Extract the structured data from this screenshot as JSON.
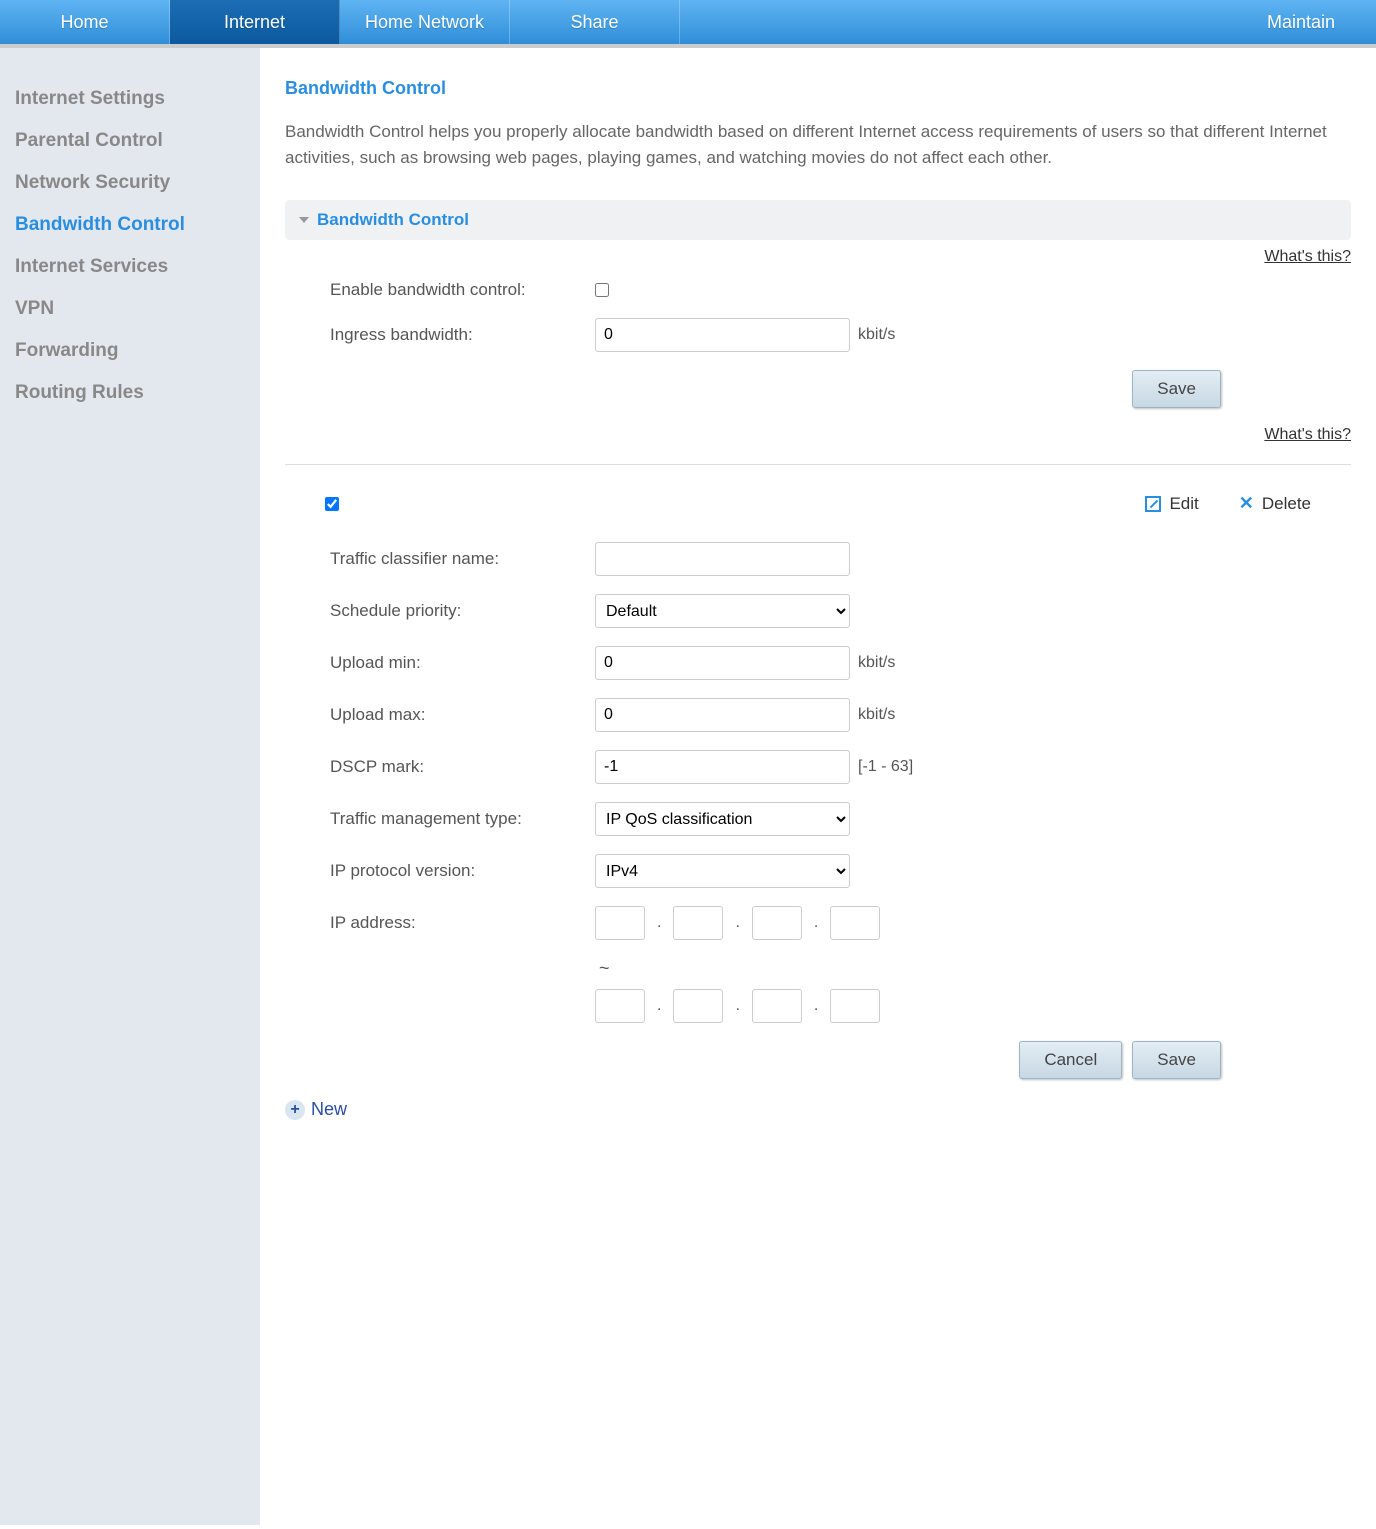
{
  "topnav": {
    "home": "Home",
    "internet": "Internet",
    "home_network": "Home Network",
    "share": "Share",
    "maintain": "Maintain"
  },
  "sidebar": {
    "items": [
      "Internet Settings",
      "Parental Control",
      "Network Security",
      "Bandwidth Control",
      "Internet Services",
      "VPN",
      "Forwarding",
      "Routing Rules"
    ],
    "active_index": 3
  },
  "page": {
    "title": "Bandwidth Control",
    "description": "Bandwidth Control helps you properly allocate bandwidth based on different Internet access requirements of users so that different Internet activities, such as browsing web pages, playing games, and watching movies do not affect each other."
  },
  "panel": {
    "title": "Bandwidth Control",
    "whats_this": "What's this?"
  },
  "basic": {
    "enable_label": "Enable bandwidth control:",
    "enable_checked": false,
    "ingress_label": "Ingress bandwidth:",
    "ingress_value": "0",
    "unit": "kbit/s",
    "save": "Save"
  },
  "toolbar": {
    "row_checked": true,
    "edit": "Edit",
    "delete": "Delete"
  },
  "rule": {
    "name_label": "Traffic classifier name:",
    "name_value": "",
    "priority_label": "Schedule priority:",
    "priority_value": "Default",
    "upmin_label": "Upload min:",
    "upmin_value": "0",
    "upmax_label": "Upload max:",
    "upmax_value": "0",
    "dscp_label": "DSCP mark:",
    "dscp_value": "-1",
    "dscp_range": "[-1 - 63]",
    "tmt_label": "Traffic management type:",
    "tmt_value": "IP QoS classification",
    "ipver_label": "IP protocol version:",
    "ipver_value": "IPv4",
    "ipaddr_label": "IP address:",
    "tilde": "~",
    "unit": "kbit/s",
    "cancel": "Cancel",
    "save": "Save"
  },
  "newrow": {
    "label": "New"
  }
}
